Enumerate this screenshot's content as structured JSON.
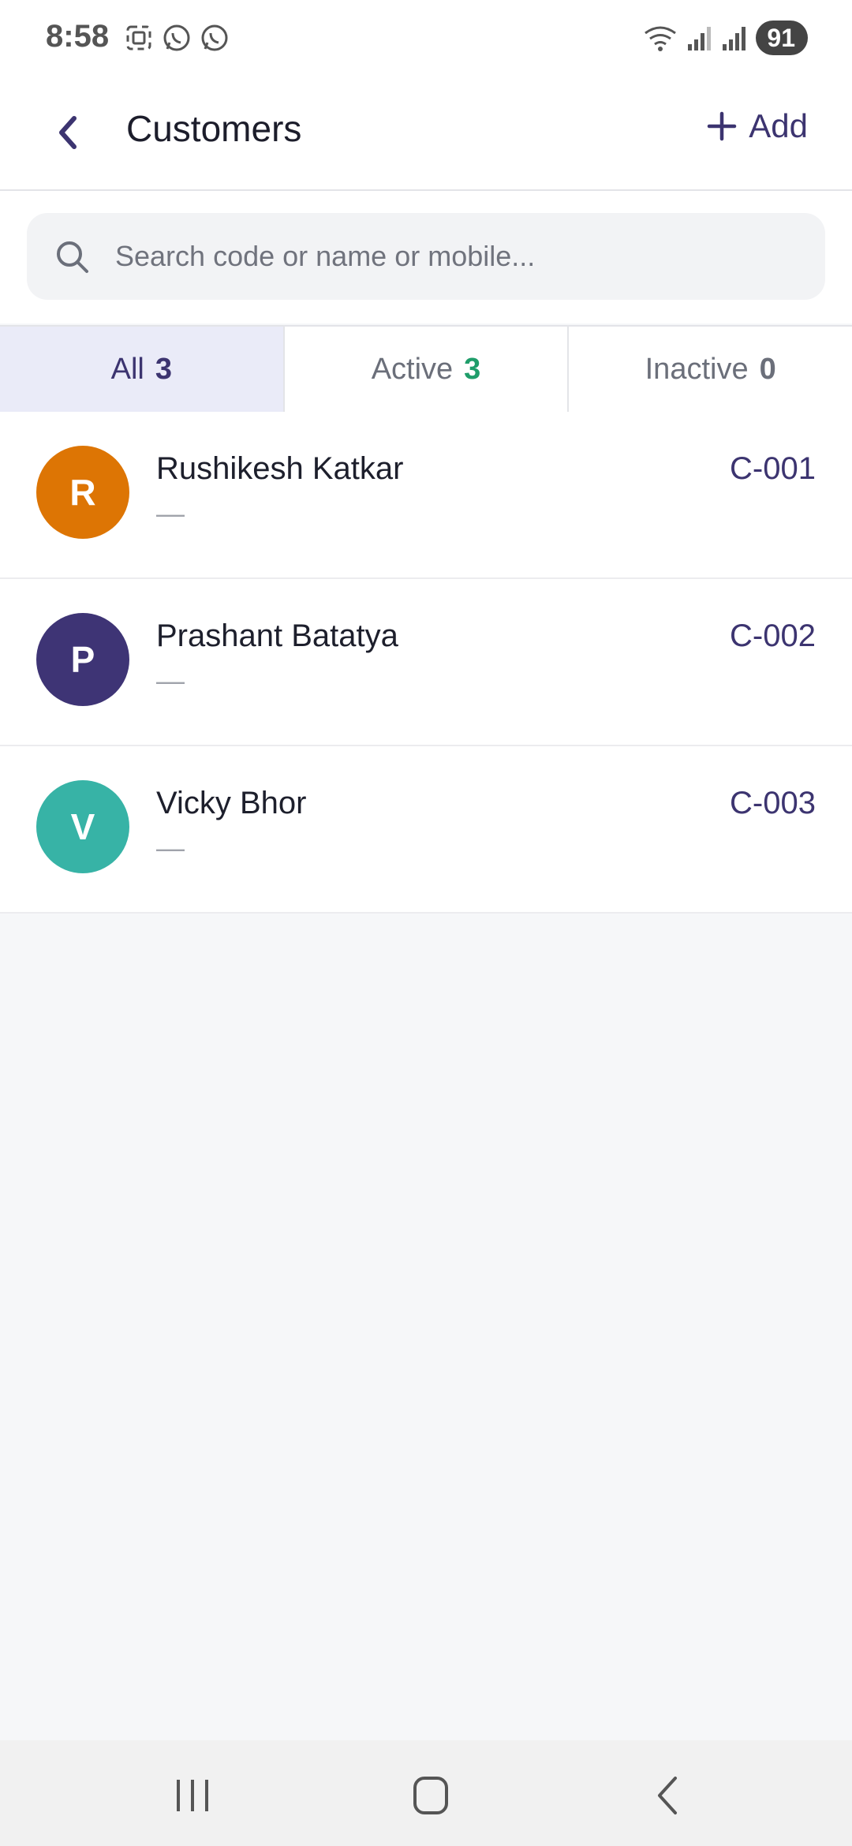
{
  "status_bar": {
    "time": "8:58",
    "battery": "91",
    "left_icons": [
      "screenshot-icon",
      "whatsapp-business-icon",
      "whatsapp-icon"
    ],
    "right_icons": [
      "wifi-icon",
      "signal-icon",
      "signal-icon"
    ]
  },
  "header": {
    "title": "Customers",
    "add_label": "Add"
  },
  "search": {
    "placeholder": "Search code or name or mobile..."
  },
  "tabs": [
    {
      "label": "All",
      "count": "3",
      "selected": true,
      "count_color": "#3c3470"
    },
    {
      "label": "Active",
      "count": "3",
      "selected": false,
      "count_color": "#1f9d6a"
    },
    {
      "label": "Inactive",
      "count": "0",
      "selected": false,
      "count_color": "#6b6f7a"
    }
  ],
  "customers": [
    {
      "initial": "R",
      "name": "Rushikesh Katkar",
      "subtitle": "—",
      "code": "C-001",
      "color": "#dd7504"
    },
    {
      "initial": "P",
      "name": "Prashant Batatya",
      "subtitle": "—",
      "code": "C-002",
      "color": "#3e3475"
    },
    {
      "initial": "V",
      "name": "Vicky Bhor",
      "subtitle": "—",
      "code": "C-003",
      "color": "#37b3a6"
    }
  ],
  "colors": {
    "accent": "#3c3470",
    "tab_selected_bg": "#eaebf8",
    "page_bg": "#f6f7f9"
  }
}
